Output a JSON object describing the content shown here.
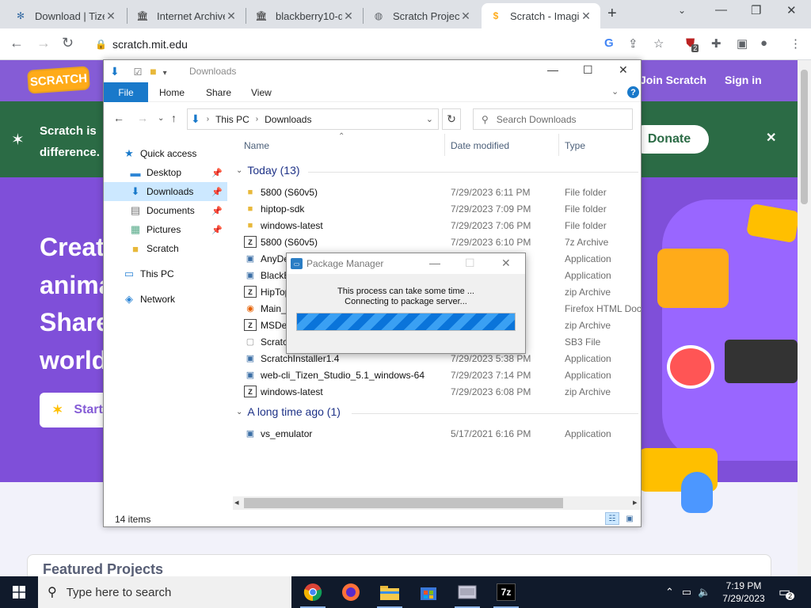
{
  "browser": {
    "tabs": [
      {
        "title": "Download | Tizen"
      },
      {
        "title": "Internet Archive"
      },
      {
        "title": "blackberry10-de"
      },
      {
        "title": "Scratch Project"
      },
      {
        "title": "Scratch - Imagin"
      }
    ],
    "url": "scratch.mit.edu",
    "extension_badge": "2"
  },
  "scratch": {
    "logo": "SCRATCH",
    "nav_join": "Join Scratch",
    "nav_signin": "Sign in",
    "banner_line1": "Scratch is",
    "banner_line2": "difference.",
    "donate": "Donate",
    "hero_lines": [
      "Creat",
      "anima",
      "Share",
      "world"
    ],
    "start_button": "Start",
    "featured": "Featured Projects"
  },
  "explorer": {
    "title": "Downloads",
    "ribbon": {
      "file": "File",
      "home": "Home",
      "share": "Share",
      "view": "View"
    },
    "breadcrumb": [
      "This PC",
      "Downloads"
    ],
    "search_placeholder": "Search Downloads",
    "nav": {
      "quick_access": "Quick access",
      "desktop": "Desktop",
      "downloads": "Downloads",
      "documents": "Documents",
      "pictures": "Pictures",
      "scratch": "Scratch",
      "this_pc": "This PC",
      "network": "Network"
    },
    "columns": {
      "name": "Name",
      "date": "Date modified",
      "type": "Type"
    },
    "groups": {
      "today": "Today (13)",
      "older": "A long time ago (1)"
    },
    "files": [
      {
        "name": "5800 (S60v5)",
        "date": "7/29/2023 6:11 PM",
        "type": "File folder"
      },
      {
        "name": "hiptop-sdk",
        "date": "7/29/2023 7:09 PM",
        "type": "File folder"
      },
      {
        "name": "windows-latest",
        "date": "7/29/2023 7:06 PM",
        "type": "File folder"
      },
      {
        "name": "5800 (S60v5)",
        "date": "7/29/2023 6:10 PM",
        "type": "7z Archive"
      },
      {
        "name": "AnyDe",
        "date": "",
        "type": "Application"
      },
      {
        "name": "BlackB",
        "date": "",
        "type": "Application"
      },
      {
        "name": "HipTop",
        "date": "",
        "type": "zip Archive"
      },
      {
        "name": "Main_",
        "date": "",
        "type": "Firefox HTML Doc..."
      },
      {
        "name": "MSDev",
        "date": "",
        "type": "zip Archive"
      },
      {
        "name": "Scratch",
        "date": "",
        "type": "SB3 File"
      },
      {
        "name": "ScratchInstaller1.4",
        "date": "7/29/2023 5:38 PM",
        "type": "Application"
      },
      {
        "name": "web-cli_Tizen_Studio_5.1_windows-64",
        "date": "7/29/2023 7:14 PM",
        "type": "Application"
      },
      {
        "name": "windows-latest",
        "date": "7/29/2023 6:08 PM",
        "type": "zip Archive"
      }
    ],
    "older_files": [
      {
        "name": "vs_emulator",
        "date": "5/17/2021 6:16 PM",
        "type": "Application"
      }
    ],
    "status": "14 items"
  },
  "package_manager": {
    "title": "Package Manager",
    "message_line1": "This process can take some time ...",
    "message_line2": "Connecting to package server...",
    "progress": 1.0
  },
  "taskbar": {
    "search_placeholder": "Type here to search",
    "time": "7:19 PM",
    "date": "7/29/2023",
    "notification_count": "2"
  },
  "colors": {
    "scratch_purple": "#855cd6",
    "banner_green": "#2b6b45",
    "explorer_accent": "#1979ca"
  }
}
